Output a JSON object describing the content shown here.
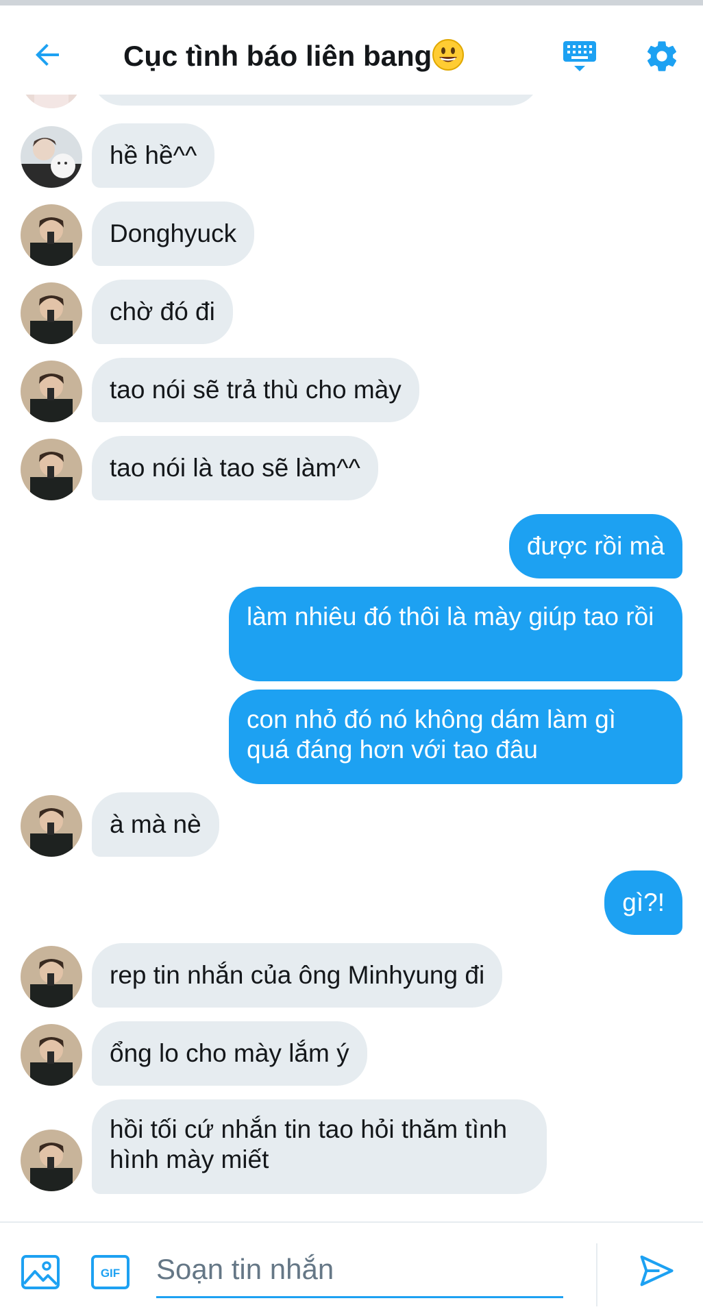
{
  "colors": {
    "accent": "#1da1f2",
    "incoming_bubble": "#e6ecf0",
    "text": "#14171a",
    "placeholder": "#657786"
  },
  "header": {
    "title": "Cục tình báo liên bang",
    "back_icon": "arrow-left-icon",
    "title_emoji": "grinning-face-emoji",
    "keyboard_icon": "keyboard-icon",
    "settings_icon": "gear-icon"
  },
  "messages": [
    {
      "side": "in",
      "text": "hề hề^^",
      "avatar": "avatar-with-plush"
    },
    {
      "side": "in",
      "text": "Donghyuck",
      "avatar": "avatar-dark-jacket"
    },
    {
      "side": "in",
      "text": "chờ đó đi",
      "avatar": "avatar-dark-jacket"
    },
    {
      "side": "in",
      "text": "tao nói sẽ trả thù cho mày",
      "avatar": "avatar-dark-jacket"
    },
    {
      "side": "in",
      "text": "tao nói là tao sẽ làm^^",
      "avatar": "avatar-dark-jacket"
    },
    {
      "side": "out",
      "text": "được rồi mà"
    },
    {
      "side": "out",
      "text": "làm nhiêu đó thôi là mày giúp tao rồi"
    },
    {
      "side": "out",
      "text": "con nhỏ đó nó không dám làm gì quá đáng hơn với tao đâu"
    },
    {
      "side": "in",
      "text": "à mà nè",
      "avatar": "avatar-dark-jacket"
    },
    {
      "side": "out",
      "text": "gì?!"
    },
    {
      "side": "in",
      "text": "rep tin nhắn của ông Minhyung đi",
      "avatar": "avatar-dark-jacket"
    },
    {
      "side": "in",
      "text": "ổng lo cho mày lắm ý",
      "avatar": "avatar-dark-jacket"
    },
    {
      "side": "in",
      "text": "hồi tối cứ nhắn tin tao hỏi thăm tình hình mày miết",
      "avatar": "avatar-dark-jacket"
    }
  ],
  "composer": {
    "placeholder": "Soạn tin nhắn",
    "image_icon": "image-icon",
    "gif_icon": "gif-icon",
    "gif_label": "GIF",
    "send_icon": "send-icon"
  }
}
